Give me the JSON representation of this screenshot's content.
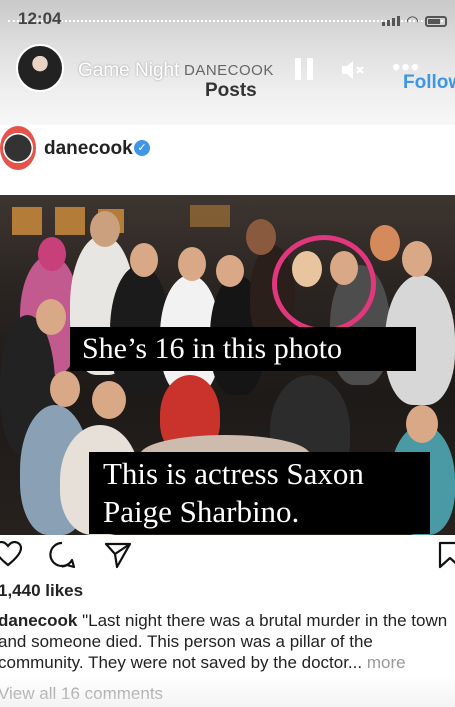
{
  "status": {
    "time": "12:04"
  },
  "story": {
    "title": "Game Night",
    "posts_owner": "DANECOOK",
    "posts_label": "Posts",
    "follow_label": "Follow"
  },
  "post": {
    "username": "danecook",
    "verified_mark": "✓",
    "photo_captions": {
      "caption_1": "She’s 16 in this photo",
      "caption_2_line1": "This is actress Saxon",
      "caption_2_line2": "Paige Sharbino."
    },
    "likes": "1,440 likes",
    "caption_username": "danecook",
    "caption_body": "\"Last night there was a brutal murder in the town and someone died. This person was a pillar of the community. They were not saved by the doctor...",
    "more_label": "more",
    "comments_link": "View all 16 comments"
  },
  "icons": {
    "like": "heart-icon",
    "comment": "comment-icon",
    "share": "share-icon",
    "save": "bookmark-icon",
    "pause": "pause-icon",
    "mute": "mute-icon",
    "more": "more-icon"
  },
  "colors": {
    "follow_blue": "#3d96e6",
    "highlight_circle": "#e0377d",
    "caption_background": "#000000"
  }
}
